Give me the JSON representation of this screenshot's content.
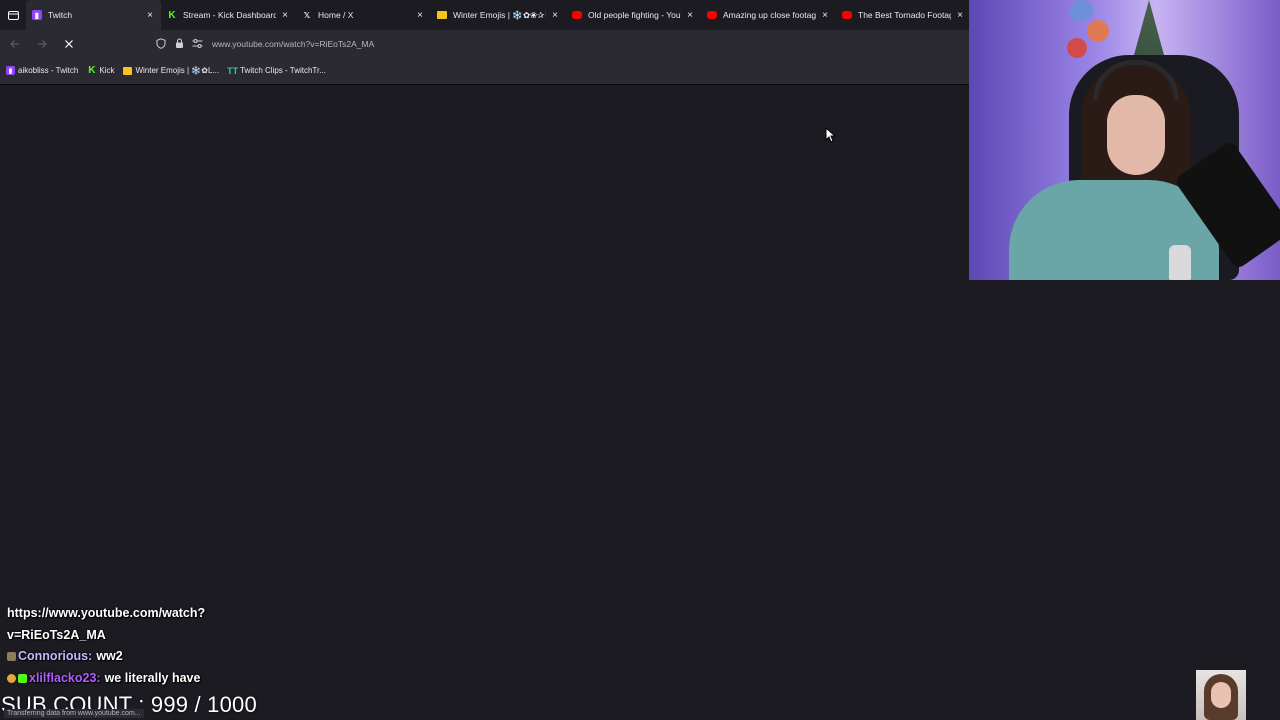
{
  "browser": {
    "tabs": [
      {
        "label": "Twitch",
        "icon": "twitch-icon",
        "active": true
      },
      {
        "label": "Stream - Kick Dashboard",
        "icon": "kick-icon",
        "active": false
      },
      {
        "label": "Home / X",
        "icon": "x-icon",
        "active": false
      },
      {
        "label": "Winter Emojis | ❄️✿❀✰☃❅",
        "icon": "folder-icon",
        "active": false
      },
      {
        "label": "Old people fighting - YouTube",
        "icon": "youtube-icon",
        "active": false
      },
      {
        "label": "Amazing up close footage",
        "icon": "youtube-icon",
        "active": false
      },
      {
        "label": "The Best Tornado Footage",
        "icon": "youtube-icon",
        "active": false
      }
    ],
    "close_glyph": "×",
    "url": "www.youtube.com/watch?v=RiEoTs2A_MA",
    "bookmarks": [
      {
        "label": "aikobliss - Twitch",
        "icon": "twitch-icon"
      },
      {
        "label": "Kick",
        "icon": "kick-icon"
      },
      {
        "label": "Winter Emojis | ❄️✿L...",
        "icon": "folder-icon"
      },
      {
        "label": "Twitch Clips - TwitchTr...",
        "icon": "twitchtracker-icon"
      }
    ],
    "status_text": "Transferring data from www.youtube.com..."
  },
  "chat": {
    "messages": [
      {
        "user": "",
        "text": "https://www.youtube.com/watch?"
      },
      {
        "user": "",
        "text": "v=RiEoTs2A_MA"
      },
      {
        "user": "Connorious",
        "separator": ":",
        "text": "ww2"
      },
      {
        "user": "xlilflacko23",
        "separator": ":",
        "text": "we literally have"
      }
    ]
  },
  "overlay": {
    "sub_count": "SUB COUNT : 999 / 1000"
  },
  "colors": {
    "chrome_dark": "#1c1b22",
    "chrome_toolbar": "#2b2a33",
    "twitch_purple": "#9146ff",
    "kick_green": "#53fc18",
    "youtube_red": "#ff0000"
  }
}
